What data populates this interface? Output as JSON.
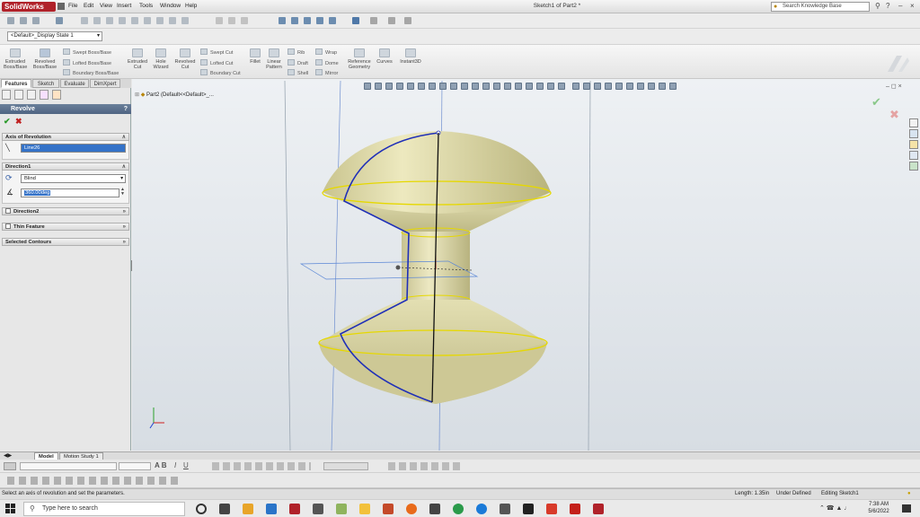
{
  "app": {
    "logo_text": "SolidWorks",
    "menus": [
      "File",
      "Edit",
      "View",
      "Insert",
      "Tools",
      "Window",
      "Help"
    ],
    "doc_title": "Sketch1 of Part2 *",
    "search_placeholder": "Search Knowledge Base",
    "help_symbol": "?",
    "brand_color": "#b0222a"
  },
  "config": {
    "value": "<Default>_Display State 1"
  },
  "command_manager": {
    "large": [
      {
        "label": "Extruded\nBoss/Base"
      },
      {
        "label": "Revolved\nBoss/Base"
      },
      {
        "label": "Extruded\nCut"
      },
      {
        "label": "Hole\nWizard"
      },
      {
        "label": "Revolved\nCut"
      },
      {
        "label": "Fillet"
      },
      {
        "label": "Linear\nPattern"
      },
      {
        "label": "Reference\nGeometry"
      },
      {
        "label": "Curves"
      },
      {
        "label": "Instant3D"
      }
    ],
    "small": [
      "Swept Boss/Base",
      "Lofted Boss/Base",
      "Boundary Boss/Base",
      "Swept Cut",
      "Lofted Cut",
      "Boundary Cut",
      "Rib",
      "Draft",
      "Shell",
      "Wrap",
      "Dome",
      "Mirror"
    ]
  },
  "tabs": [
    "Features",
    "Sketch",
    "Evaluate",
    "DimXpert"
  ],
  "property_manager": {
    "title": "Revolve",
    "help": "?",
    "axis_section": {
      "title": "Axis of Revolution",
      "value": "Line26"
    },
    "direction1": {
      "title": "Direction1",
      "type": "Blind",
      "angle": "360.00deg"
    },
    "direction2": {
      "title": "Direction2"
    },
    "thin_feature": {
      "title": "Thin Feature"
    },
    "selected_contours": {
      "title": "Selected Contours"
    }
  },
  "tree": {
    "item": "Part2  (Default<<Default>_..."
  },
  "bottom_tabs": [
    "Model",
    "Motion Study 1"
  ],
  "status": {
    "message": "Select an axis of revolution and set the parameters.",
    "length": "Length: 1.35in",
    "defined": "Under Defined",
    "editing": "Editing Sketch1"
  },
  "taskbar": {
    "search_placeholder": "Type here to search",
    "time": "7:38 AM",
    "date": "5/6/2022"
  }
}
